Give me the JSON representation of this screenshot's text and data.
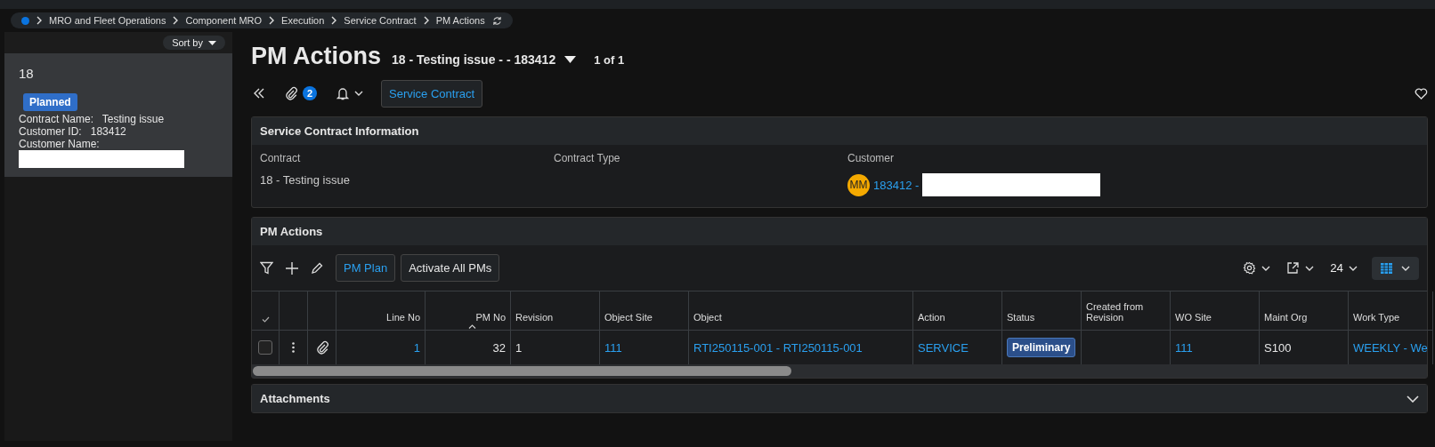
{
  "breadcrumb": [
    "MRO and Fleet Operations",
    "Component MRO",
    "Execution",
    "Service Contract",
    "PM Actions"
  ],
  "sidebar": {
    "sort_label": "Sort by",
    "cards": [
      {
        "title": "18",
        "selected": true,
        "status": "Planned",
        "fields": [
          {
            "label": "Contract Name:",
            "value": "Testing issue",
            "redacted": false
          },
          {
            "label": "Customer ID:",
            "value": "183412",
            "redacted": false
          },
          {
            "label": "Customer Name:",
            "redacted": true
          }
        ]
      }
    ]
  },
  "header": {
    "title": "PM Actions",
    "record": "18 - Testing issue - - 183412",
    "counter": "1 of 1",
    "attachment_count": "2",
    "button": "Service Contract"
  },
  "info_panel": {
    "title": "Service Contract Information",
    "fields": [
      {
        "label": "Contract",
        "value": "18 - Testing issue"
      },
      {
        "label": "Contract Type"
      },
      {
        "label": "Customer",
        "avatar": "MM",
        "link": "183412 -",
        "redacted": true
      }
    ]
  },
  "pm_panel": {
    "title": "PM Actions",
    "buttons": [
      {
        "label": "PM Plan",
        "kind": "link"
      },
      {
        "label": "Activate All PMs",
        "kind": "plain"
      }
    ],
    "page_size": "24",
    "columns": [
      {
        "label": "Line No",
        "sorted": false
      },
      {
        "label": "PM No",
        "sorted": true
      },
      {
        "label": "Revision",
        "sorted": false
      },
      {
        "label": "Object Site",
        "sorted": false
      },
      {
        "label": "Object",
        "sorted": false
      },
      {
        "label": "Action",
        "sorted": false
      },
      {
        "label": "Status",
        "sorted": false
      },
      {
        "label": "Created from Revision",
        "sorted": false
      },
      {
        "label": "WO Site",
        "sorted": false
      },
      {
        "label": "Maint Org",
        "sorted": false
      },
      {
        "label": "Work Type",
        "sorted": false
      }
    ],
    "rows": [
      {
        "checked": false,
        "cells": [
          {
            "kind": "link",
            "text": "1"
          },
          {
            "kind": "text",
            "text": "32"
          },
          {
            "kind": "text",
            "text": "1"
          },
          {
            "kind": "link",
            "text": "111"
          },
          {
            "kind": "link",
            "text": "RTI250115-001 - RTI250115-001"
          },
          {
            "kind": "link",
            "text": "SERVICE"
          },
          {
            "kind": "badge",
            "text": "Preliminary"
          },
          {
            "kind": "empty"
          },
          {
            "kind": "link",
            "text": "111"
          },
          {
            "kind": "text",
            "text": "S100"
          },
          {
            "kind": "link",
            "text": "WEEKLY - We"
          }
        ]
      }
    ]
  },
  "attachments_panel": {
    "title": "Attachments",
    "expanded": false
  }
}
